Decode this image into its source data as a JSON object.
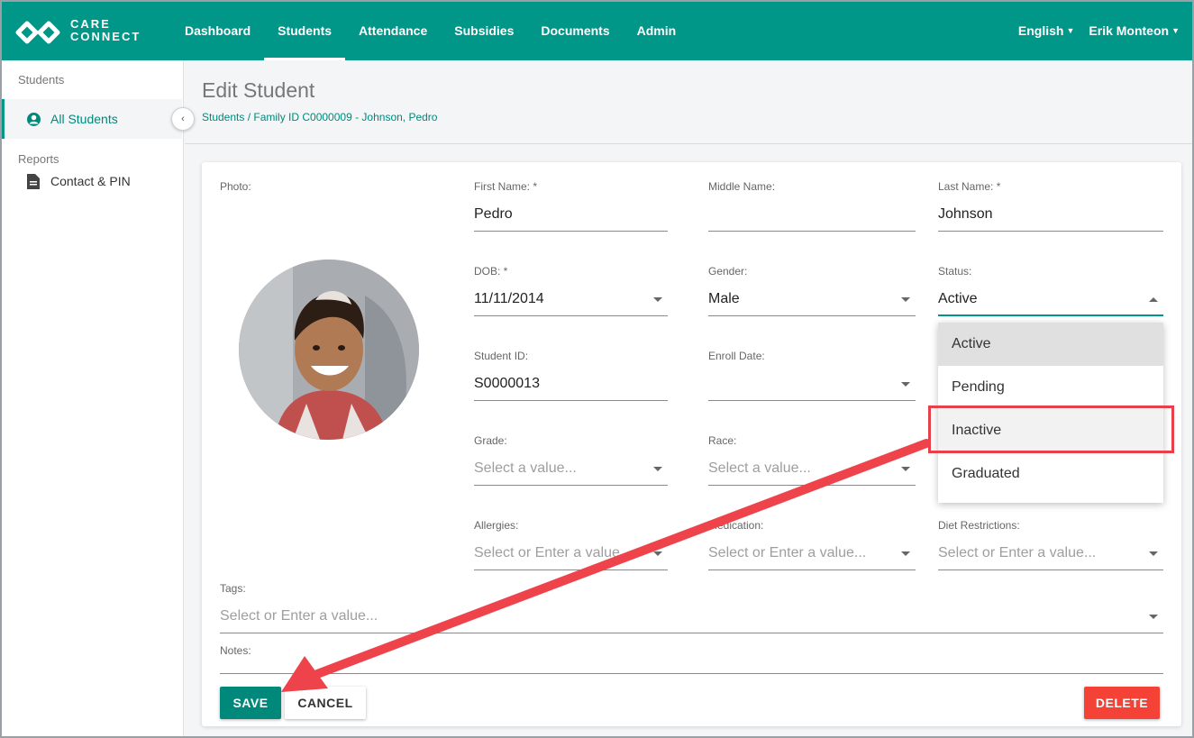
{
  "app": {
    "logo_top": "CARE",
    "logo_bottom": "CONNECT"
  },
  "nav": [
    {
      "label": "Dashboard"
    },
    {
      "label": "Students",
      "active": true
    },
    {
      "label": "Attendance"
    },
    {
      "label": "Subsidies"
    },
    {
      "label": "Documents"
    },
    {
      "label": "Admin"
    }
  ],
  "header_right": {
    "language": "English",
    "user": "Erik Monteon"
  },
  "sidebar": {
    "students_section": "Students",
    "all_students": "All Students",
    "reports_section": "Reports",
    "contact_pin": "Contact & PIN"
  },
  "page": {
    "title": "Edit Student",
    "breadcrumb": "Students / Family ID C0000009 - Johnson, Pedro"
  },
  "form": {
    "photo_label": "Photo:",
    "first_name": {
      "label": "First Name: *",
      "value": "Pedro"
    },
    "middle_name": {
      "label": "Middle Name:",
      "value": ""
    },
    "last_name": {
      "label": "Last Name: *",
      "value": "Johnson"
    },
    "dob": {
      "label": "DOB: *",
      "value": "11/11/2014"
    },
    "gender": {
      "label": "Gender:",
      "value": "Male"
    },
    "status": {
      "label": "Status:",
      "value": "Active"
    },
    "student_id": {
      "label": "Student ID:",
      "value": "S0000013"
    },
    "enroll_date": {
      "label": "Enroll Date:",
      "value": ""
    },
    "grade": {
      "label": "Grade:",
      "placeholder": "Select a value..."
    },
    "race": {
      "label": "Race:",
      "placeholder": "Select a value..."
    },
    "allergies": {
      "label": "Allergies:",
      "placeholder": "Select or Enter a value..."
    },
    "medication": {
      "label": "Medication:",
      "placeholder": "Select or Enter a value..."
    },
    "diet": {
      "label": "Diet Restrictions:",
      "placeholder": "Select or Enter a value..."
    },
    "tags": {
      "label": "Tags:",
      "placeholder": "Select or Enter a value..."
    },
    "notes": {
      "label": "Notes:",
      "value": ""
    }
  },
  "status_dropdown": {
    "options": [
      "Active",
      "Pending",
      "Inactive",
      "Graduated"
    ],
    "selected": "Active",
    "highlighted": "Inactive"
  },
  "buttons": {
    "save": "SAVE",
    "cancel": "CANCEL",
    "delete": "DELETE"
  },
  "colors": {
    "brand": "#009688",
    "danger": "#f44336",
    "annotation": "#e8404a"
  }
}
